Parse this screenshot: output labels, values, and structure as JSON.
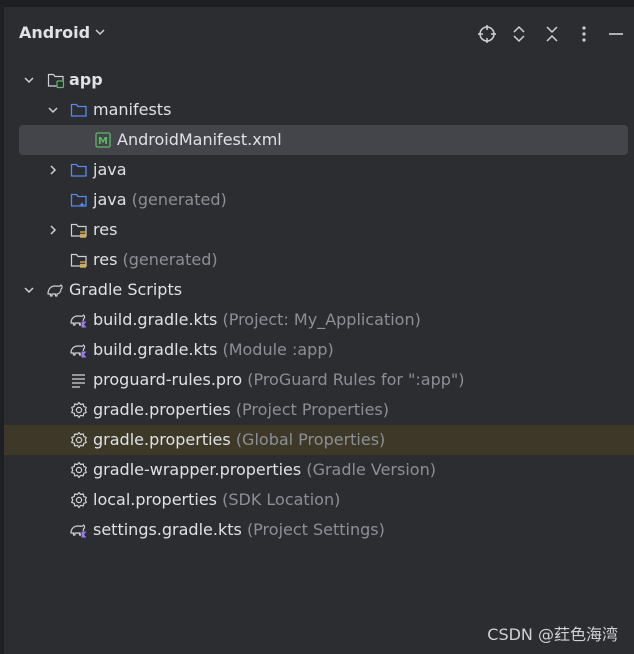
{
  "panel": {
    "title": "Android"
  },
  "tree": {
    "rows": [
      {
        "name": "app",
        "hint": ""
      },
      {
        "name": "manifests",
        "hint": ""
      },
      {
        "name": "AndroidManifest.xml",
        "hint": ""
      },
      {
        "name": "java",
        "hint": ""
      },
      {
        "name": "java",
        "hint": "(generated)"
      },
      {
        "name": "res",
        "hint": ""
      },
      {
        "name": "res",
        "hint": "(generated)"
      },
      {
        "name": "Gradle Scripts",
        "hint": ""
      },
      {
        "name": "build.gradle.kts",
        "hint": "(Project: My_Application)"
      },
      {
        "name": "build.gradle.kts",
        "hint": "(Module :app)"
      },
      {
        "name": "proguard-rules.pro",
        "hint": "(ProGuard Rules for \":app\")"
      },
      {
        "name": "gradle.properties",
        "hint": "(Project Properties)"
      },
      {
        "name": "gradle.properties",
        "hint": "(Global Properties)"
      },
      {
        "name": "gradle-wrapper.properties",
        "hint": "(Gradle Version)"
      },
      {
        "name": "local.properties",
        "hint": "(SDK Location)"
      },
      {
        "name": "settings.gradle.kts",
        "hint": "(Project Settings)"
      }
    ]
  },
  "icons": {
    "header": [
      "locate-icon",
      "expand-all-icon",
      "collapse-all-icon",
      "more-options-icon",
      "hide-icon"
    ]
  },
  "colors": {
    "background": "#2b2d30",
    "selection": "#43454a",
    "hover": "#3e3829",
    "hint_text": "#8c8f96",
    "folder_blue": "#548af7",
    "manifest_green": "#5fb865"
  },
  "watermark": "CSDN @荭色海湾"
}
